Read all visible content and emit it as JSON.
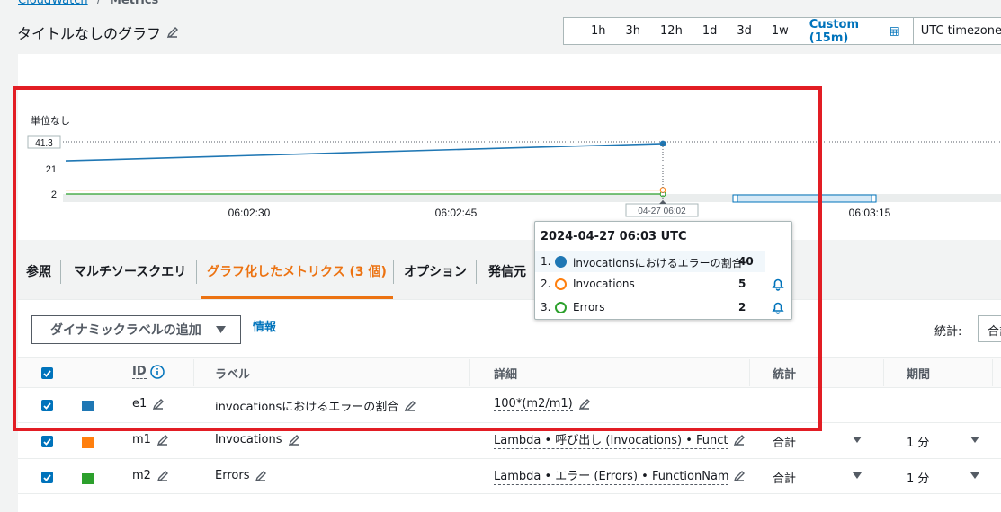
{
  "breadcrumb": {
    "service": "CloudWatch",
    "separator": "/",
    "current": "Metrics"
  },
  "title": "タイトルなしのグラフ",
  "time_range": {
    "options": [
      "1h",
      "3h",
      "12h",
      "1d",
      "3d",
      "1w"
    ],
    "custom": "Custom (15m)",
    "timezone": "UTC timezone"
  },
  "graph": {
    "unit_label": "単位なし",
    "y_ticks": [
      "41.3",
      "21",
      "2"
    ],
    "x_ticks": [
      "06:02:30",
      "06:02:45",
      "04-27 06:02",
      "06:03:15"
    ],
    "series": [
      {
        "name": "invocationsにおけるエラーの割合",
        "color": "#1f77b4",
        "start": 27,
        "end": 40
      },
      {
        "name": "Invocations",
        "color": "#ff7f0e",
        "start": 5,
        "end": 5
      },
      {
        "name": "Errors",
        "color": "#2ca02c",
        "start": 2,
        "end": 2
      }
    ]
  },
  "tooltip": {
    "title": "2024-04-27 06:03 UTC",
    "rows": [
      {
        "num": "1.",
        "name": "invocationsにおけるエラーの割合",
        "value": "40",
        "color": "#1f77b4"
      },
      {
        "num": "2.",
        "name": "Invocations",
        "value": "5",
        "color": "#ff7f0e"
      },
      {
        "num": "3.",
        "name": "Errors",
        "value": "2",
        "color": "#2ca02c"
      }
    ]
  },
  "tabs": [
    "参照",
    "マルチソースクエリ",
    "グラフ化したメトリクス (3 個)",
    "オプション",
    "発信元"
  ],
  "toolbar": {
    "dynamic_label": "ダイナミックラベルの追加",
    "info": "情報",
    "stat_label": "統計:",
    "stat_value": "合計"
  },
  "table": {
    "headers": {
      "id": "ID",
      "label": "ラベル",
      "detail": "詳細",
      "stat": "統計",
      "period": "期間"
    },
    "rows": [
      {
        "id": "e1",
        "label": "invocationsにおけるエラーの割合",
        "detail": "100*(m2/m1)",
        "stat": "",
        "period": "",
        "color": "#1f77b4"
      },
      {
        "id": "m1",
        "label": "Invocations",
        "detail": "Lambda • 呼び出し (Invocations) • FunctionName",
        "stat": "合計",
        "period": "1 分",
        "color": "#ff7f0e"
      },
      {
        "id": "m2",
        "label": "Errors",
        "detail": "Lambda • エラー (Errors) • FunctionName",
        "stat": "合計",
        "period": "1 分",
        "color": "#2ca02c"
      }
    ]
  },
  "highlight_color": "#e21d24"
}
